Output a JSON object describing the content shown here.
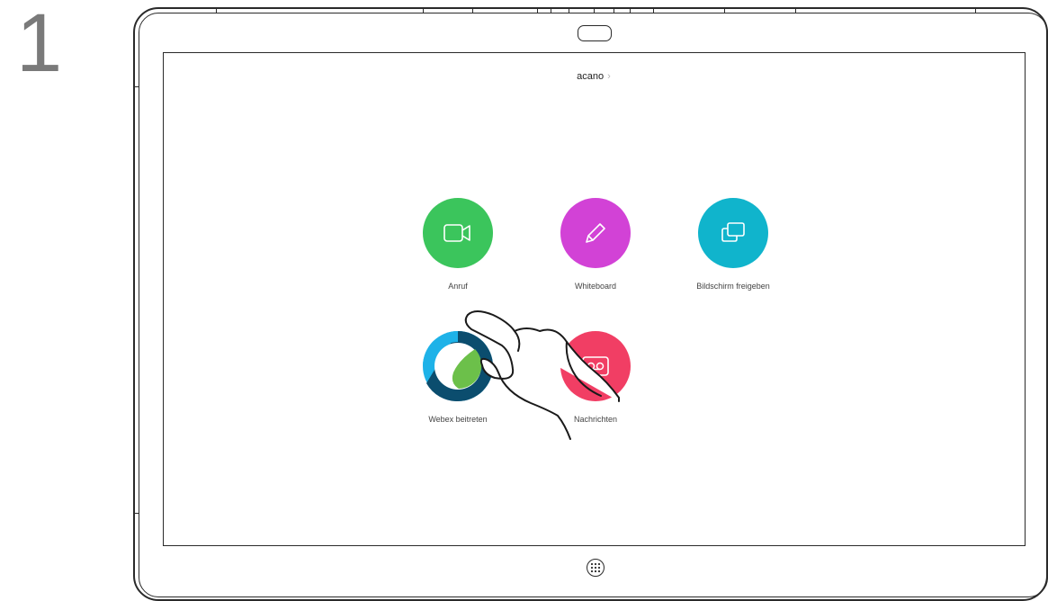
{
  "step_number": "1",
  "screen": {
    "header_title": "acano",
    "header_chevron": "›",
    "tiles": [
      {
        "label": "Anruf",
        "icon": "video-camera-icon",
        "color": "#3bc55c"
      },
      {
        "label": "Whiteboard",
        "icon": "pencil-icon",
        "color": "#d242d6"
      },
      {
        "label": "Bildschirm freigeben",
        "icon": "share-screen-icon",
        "color": "#10b4cc"
      },
      {
        "label": "Webex beitreten",
        "icon": "webex-logo-icon",
        "color": "#1eb2e8"
      },
      {
        "label": "Nachrichten",
        "icon": "voicemail-icon",
        "color": "#f13e64"
      }
    ]
  },
  "device": {
    "home_button_icon": "home-button-icon",
    "camera_icon": "camera-icon"
  }
}
